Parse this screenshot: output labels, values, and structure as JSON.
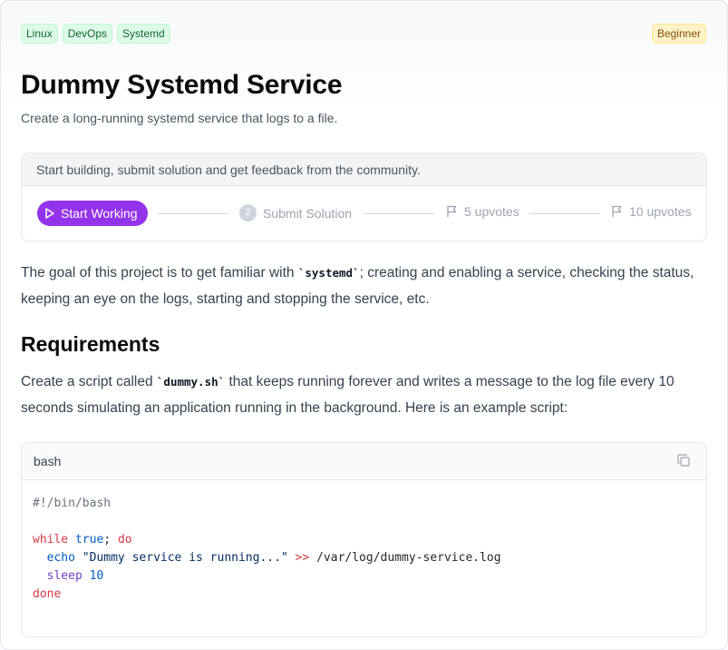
{
  "tags": [
    "Linux",
    "DevOps",
    "Systemd"
  ],
  "difficulty": "Beginner",
  "title": "Dummy Systemd Service",
  "subtitle": "Create a long-running systemd service that logs to a file.",
  "progress": {
    "hint": "Start building, submit solution and get feedback from the community.",
    "start_label": "Start Working",
    "step2_number": "2",
    "step2_label": "Submit Solution",
    "upvotes_5": "5 upvotes",
    "upvotes_10": "10 upvotes"
  },
  "intro": {
    "before": "The goal of this project is to get familiar with ",
    "code": "`systemd`",
    "after": "; creating and enabling a service, checking the status, keeping an eye on the logs, starting and stopping the service, etc."
  },
  "requirements": {
    "heading": "Requirements",
    "before": "Create a script called ",
    "code": "`dummy.sh`",
    "after": " that keeps running forever and writes a message to the log file every 10 seconds simulating an application running in the background. Here is an example script:"
  },
  "code_block": {
    "language": "bash",
    "shebang": "#!/bin/bash",
    "while_kw": "while",
    "true_kw": "true",
    "semicolon": ";",
    "do_kw": "do",
    "echo_cmd": "echo",
    "echo_str": "\"Dummy service is running...\"",
    "redirect": ">>",
    "log_path": "/var/log/dummy-service.log",
    "sleep_cmd": "sleep",
    "sleep_val": "10",
    "done_kw": "done"
  },
  "colors": {
    "accent_purple": "#9333ea",
    "tag_green": "#dcfce7",
    "badge_yellow": "#fef3c7"
  }
}
